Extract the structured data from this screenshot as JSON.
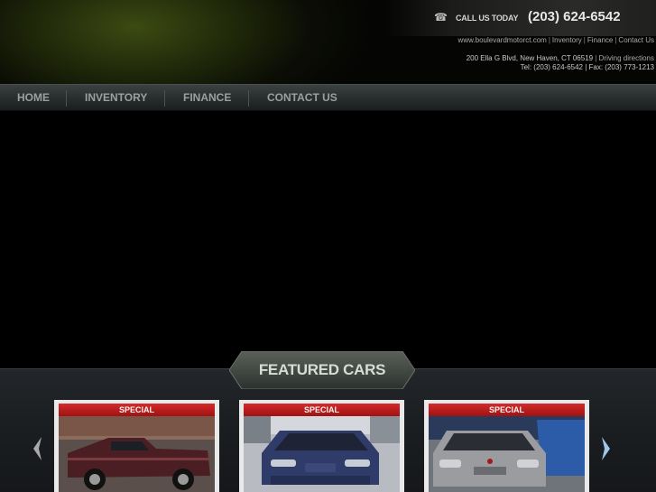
{
  "header": {
    "call_label": "CALL US TODAY",
    "phone": "(203) 624-6542",
    "toplinks": [
      "www.boulevardmotorct.com",
      "Inventory",
      "Finance",
      "Contact Us"
    ],
    "address_line": "200 Ella G Blvd, New Haven, CT 06519",
    "directions": "Driving directions",
    "contact_line": "Tel: (203) 624-6542 | Fax: (203) 773-1213"
  },
  "nav": [
    {
      "label": "HOME"
    },
    {
      "label": "INVENTORY"
    },
    {
      "label": "FINANCE"
    },
    {
      "label": "CONTACT US"
    }
  ],
  "featured": {
    "title": "FEATURED CARS",
    "cards": [
      {
        "badge": "SPECIAL"
      },
      {
        "badge": "SPECIAL"
      },
      {
        "badge": "SPECIAL"
      }
    ]
  },
  "icons": {
    "phone": "phone-icon",
    "prev": "chevron-left-icon",
    "next": "chevron-right-icon"
  },
  "colors": {
    "accent_red": "#c41e1e",
    "arrow_blue": "#9fc8e8",
    "nav_text": "#9aa0a0"
  }
}
